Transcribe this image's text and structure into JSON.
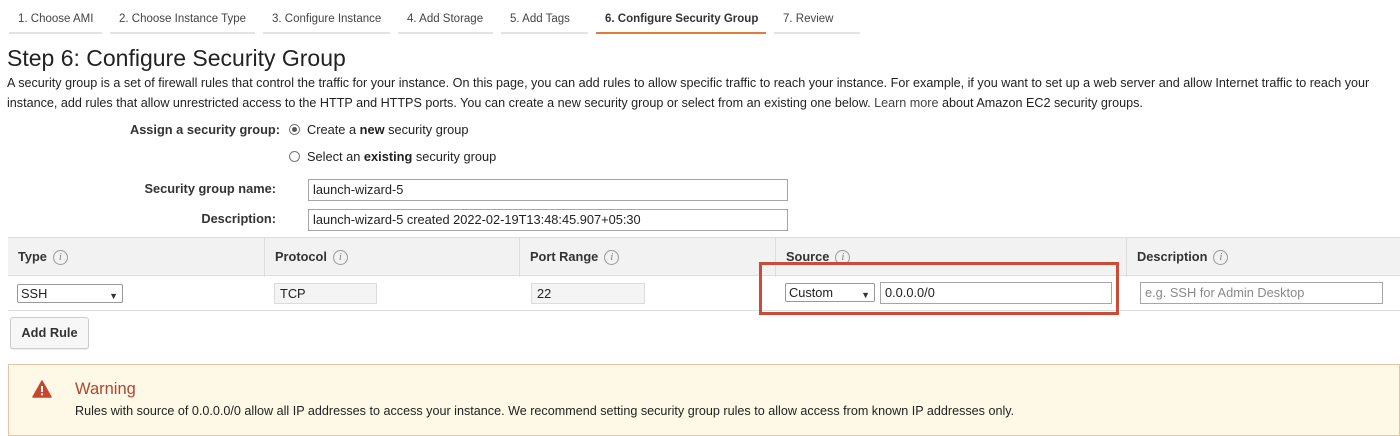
{
  "wizard": {
    "tabs": [
      {
        "label": "1. Choose AMI",
        "active": false
      },
      {
        "label": "2. Choose Instance Type",
        "active": false
      },
      {
        "label": "3. Configure Instance",
        "active": false
      },
      {
        "label": "4. Add Storage",
        "active": false
      },
      {
        "label": "5. Add Tags",
        "active": false
      },
      {
        "label": "6. Configure Security Group",
        "active": true
      },
      {
        "label": "7. Review",
        "active": false
      }
    ]
  },
  "step": {
    "title": "Step 6: Configure Security Group",
    "intro_line1": "A security group is a set of firewall rules that control the traffic for your instance. On this page, you can add rules to allow specific traffic to reach your instance. For example, if you want to set up a web server and allow Internet traffic to reach your",
    "intro_line2_before": "instance, add rules that allow unrestricted access to the HTTP and HTTPS ports. You can create a new security group or select from an existing one below.",
    "learn_more": "Learn more",
    "intro_line2_after": "about Amazon EC2 security groups."
  },
  "form": {
    "assign_label": "Assign a security group:",
    "create_new": {
      "prefix": "Create a ",
      "bold": "new",
      "suffix": " security group",
      "selected": true
    },
    "select_existing": {
      "prefix": "Select an ",
      "bold": "existing",
      "suffix": " security group",
      "selected": false
    },
    "name_label": "Security group name:",
    "name_value": "launch-wizard-5",
    "description_label": "Description:",
    "description_value": "launch-wizard-5 created 2022-02-19T13:48:45.907+05:30"
  },
  "rules_table": {
    "columns": [
      "Type",
      "Protocol",
      "Port Range",
      "Source",
      "Description"
    ],
    "info_glyph": "i",
    "rows": [
      {
        "type": "SSH",
        "protocol": "TCP",
        "port_range": "22",
        "source_mode": "Custom",
        "source_cidr": "0.0.0.0/0",
        "description_placeholder": "e.g. SSH for Admin Desktop"
      }
    ]
  },
  "actions": {
    "add_rule": "Add Rule"
  },
  "warning": {
    "title": "Warning",
    "message": "Rules with source of 0.0.0.0/0 allow all IP addresses to access your instance. We recommend setting security group rules to allow access from known IP addresses only."
  },
  "icons": {
    "info": "info-icon",
    "select_arrow": "chevron-down-icon",
    "warning": "warning-triangle-icon"
  },
  "colors": {
    "active_tab": "#e07b39",
    "highlight_box": "#cc4b37",
    "warning_title": "#b04632",
    "warning_bg": "#fdf9e6"
  }
}
